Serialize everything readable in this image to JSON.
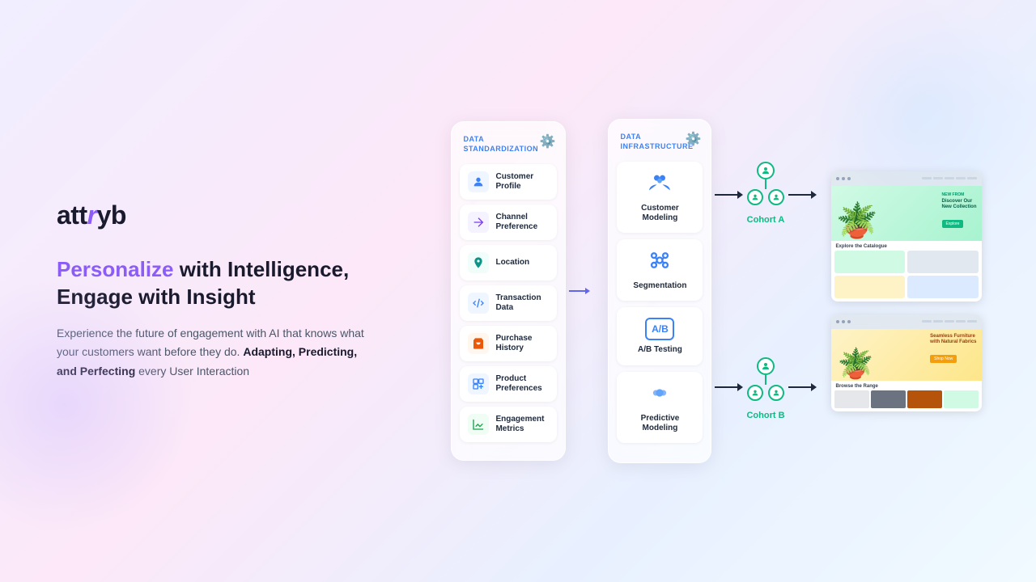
{
  "logo": {
    "att": "att",
    "r": "r",
    "yb": "yb"
  },
  "headline": {
    "personalize": "Personalize",
    "rest": " with Intelligence,\nEngage with Insight"
  },
  "description": {
    "main": "Experience the future of engagement with AI that knows what your customers want before they do. ",
    "bold": "Adapting, Predicting, and Perfecting",
    "end": " every User Interaction"
  },
  "panels": {
    "standardization": {
      "title": "DATA\nSTANDARDIZATION",
      "items": [
        {
          "label": "Customer\nProfile",
          "icon": "👤"
        },
        {
          "label": "Channel\nPreference",
          "icon": "🔄"
        },
        {
          "label": "Location",
          "icon": "📍"
        },
        {
          "label": "Transaction\nData",
          "icon": "↔️"
        },
        {
          "label": "Purchase\nHistory",
          "icon": "🛒"
        },
        {
          "label": "Product\nPreferences",
          "icon": "⭐"
        },
        {
          "label": "Engagement\nMetrics",
          "icon": "📊"
        }
      ]
    },
    "infrastructure": {
      "title": "DATA\nINFRASTRUCTURE",
      "items": [
        {
          "label": "Customer\nModeling"
        },
        {
          "label": "Segmentation"
        },
        {
          "label": "A/B Testing"
        },
        {
          "label": "Predictive\nModeling"
        }
      ]
    }
  },
  "cohorts": {
    "a": {
      "label": "Cohort A"
    },
    "b": {
      "label": "Cohort B"
    }
  },
  "previews": {
    "a": {
      "tag": "NEW FROM",
      "headline": "Discover Our\nNew Collection",
      "btn": "Explore",
      "section": "Explore the Catalogue"
    },
    "b": {
      "headline": "Seamless Furniture\nwith Natural Fabrics",
      "btn": "Shop Now",
      "section": "Browse the Range"
    }
  }
}
